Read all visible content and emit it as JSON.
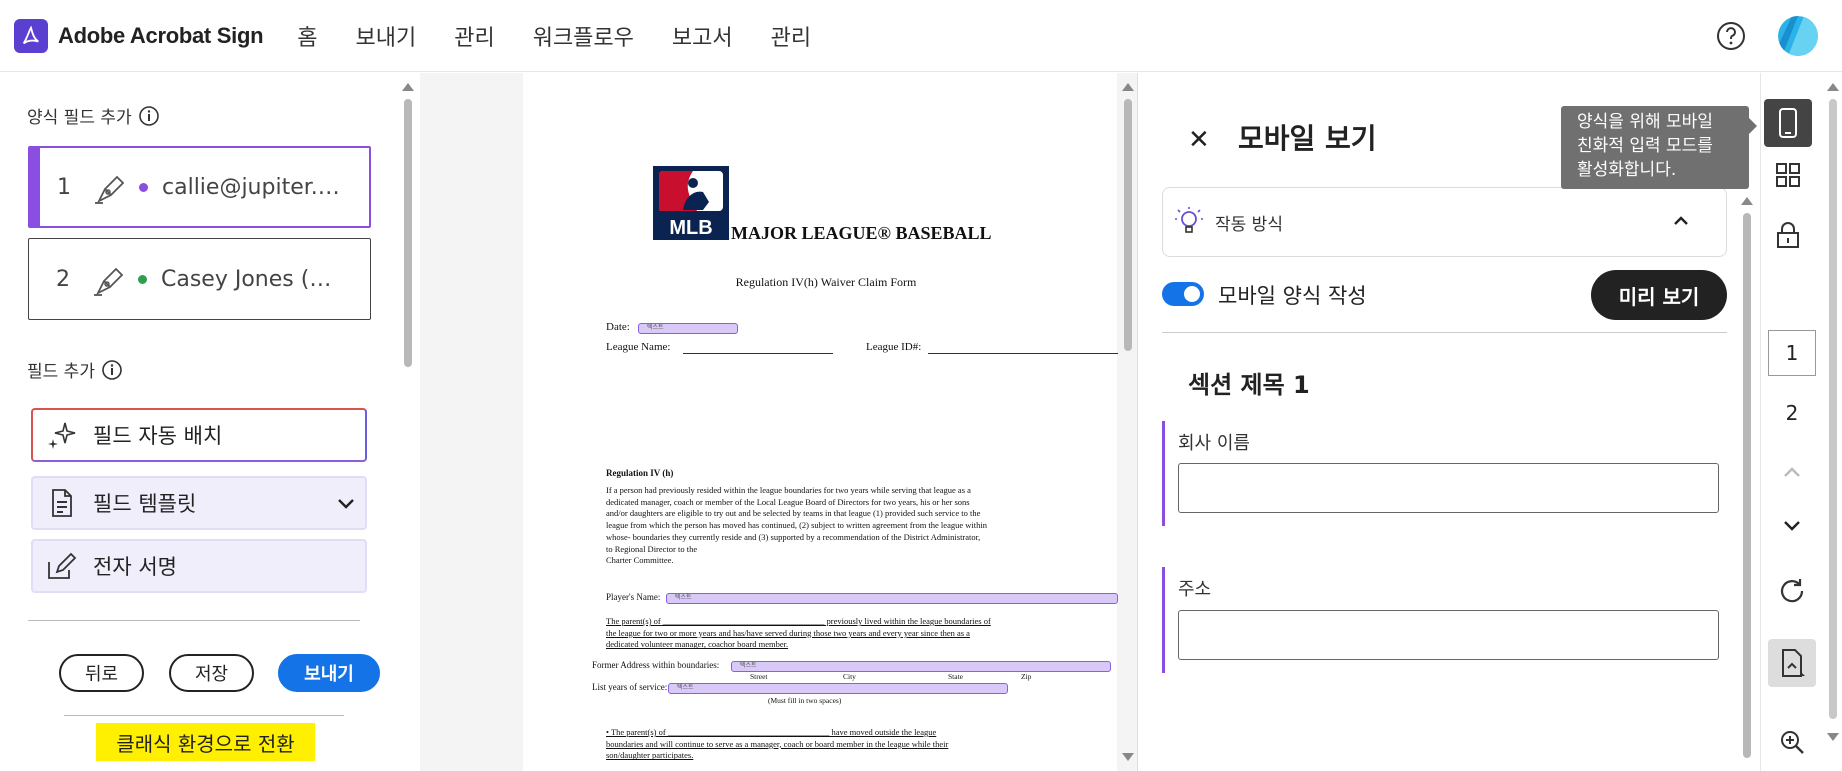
{
  "app": {
    "title": "Adobe Acrobat Sign"
  },
  "nav": [
    "홈",
    "보내기",
    "관리",
    "워크플로우",
    "보고서",
    "관리"
  ],
  "left": {
    "form_fields_label": "양식 필드 추가",
    "signers": [
      {
        "num": "1",
        "name": "callie@jupiter.…",
        "color": "#8a4fe0"
      },
      {
        "num": "2",
        "name": "Casey Jones (…",
        "color": "#2e9e4f"
      }
    ],
    "add_field_label": "필드 추가",
    "tools": {
      "auto": "필드 자동 배치",
      "template": "필드 템플릿",
      "esign": "전자 서명"
    },
    "buttons": {
      "back": "뒤로",
      "save": "저장",
      "send": "보내기"
    },
    "classic": "클래식 환경으로 전환"
  },
  "doc": {
    "logo_text": "MLB",
    "title": "MAJOR LEAGUE® BASEBALL",
    "form_title": "Regulation IV(h) Waiver Claim Form",
    "date_label": "Date:",
    "field_tag": "텍스트",
    "league_name": "League Name:",
    "league_id": "League ID#:",
    "reg_heading": "Regulation IV (h)",
    "reg_para": [
      "If a person had previously resided within the league boundaries for two years while serving that league as a",
      "dedicated manager, coach or member of the Local League Board of Directors for two years, his or her sons",
      "and/or daughters are eligible to try out and be selected by teams in that league (1) provided such service to the",
      "league from which the person has moved has continued, (2) subject to written agreement from the league within",
      "whose- boundaries they currently reside and (3) supported by a recommendation of the District Administrator,",
      "to Regional Director to the",
      "Charter Committee."
    ],
    "players_name": "Player's Name:",
    "parent_para": [
      "The parent(s) of ______________________________________ previously lived within the league boundaries of",
      "the league for two or more years and has/have served during those two years and every year since then as a",
      "dedicated volunteer manager, coachor board member."
    ],
    "former_address": "Former Address within boundaries:",
    "addr_parts": [
      "Street",
      "City",
      "State",
      "Zip"
    ],
    "list_years": "List years of service:",
    "must_fill": "(Must fill in two spaces)",
    "bullet_para": [
      "• The parent(s) of ______________________________________ have moved outside the league",
      "boundaries and will continue to serve as a manager, coach or board member in the league while their",
      "son/daughter participates."
    ]
  },
  "mobile": {
    "title": "모바일 보기",
    "how_it_works": "작동 방식",
    "toggle_label": "모바일 양식 작성",
    "preview": "미리 보기",
    "section_title": "섹션 제목 1",
    "fields": [
      "회사 이름",
      "주소"
    ],
    "tooltip": [
      "양식을 위해 모바일",
      "친화적 입력 모드를",
      "활성화합니다."
    ]
  },
  "rail": {
    "pages": [
      "1",
      "2"
    ]
  },
  "colors": {
    "accent": "#8a4fe0",
    "primary": "#1473e6",
    "brand": "#5b3fd1"
  }
}
